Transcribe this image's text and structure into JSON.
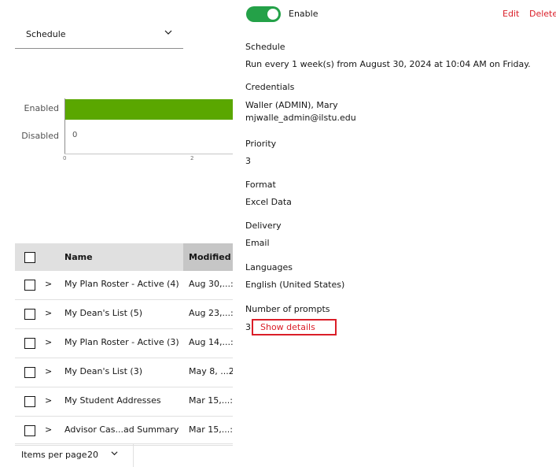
{
  "toolbar": {
    "enable_label": "Enable",
    "enabled_state": true,
    "edit_label": "Edit",
    "delete_label": "Delete"
  },
  "filter": {
    "selected": "Schedule"
  },
  "chart_data": {
    "type": "bar",
    "orientation": "horizontal",
    "categories": [
      "Enabled",
      "Disabled"
    ],
    "values": [
      3,
      0
    ],
    "value_labels": [
      "",
      "0"
    ],
    "x_ticks": [
      "0",
      "2"
    ],
    "xlim": [
      0,
      3
    ],
    "title": "",
    "xlabel": "",
    "ylabel": ""
  },
  "table": {
    "headers": {
      "name": "Name",
      "modified": "Modified"
    },
    "rows": [
      {
        "name": "My Plan Roster - Active (4)",
        "modified": "Aug 30,...:"
      },
      {
        "name": "My Dean's List (5)",
        "modified": "Aug 23,...:"
      },
      {
        "name": "My Plan Roster - Active (3)",
        "modified": "Aug 14,...:"
      },
      {
        "name": "My Dean's List (3)",
        "modified": "May 8, ...2"
      },
      {
        "name": "My Student Addresses",
        "modified": "Mar 15,...:"
      },
      {
        "name": "Advisor Cas...ad Summary",
        "modified": "Mar 15,...:"
      }
    ]
  },
  "pagination": {
    "items_per_page_label": "Items per page",
    "items_per_page_value": "20"
  },
  "details": {
    "schedule_label": "Schedule",
    "schedule_value": "Run every 1 week(s) from August 30, 2024 at 10:04 AM on Friday.",
    "credentials_label": "Credentials",
    "credentials_name": "Waller (ADMIN), Mary",
    "credentials_email": "mjwalle_admin@ilstu.edu",
    "priority_label": "Priority",
    "priority_value": "3",
    "format_label": "Format",
    "format_value": "Excel Data",
    "delivery_label": "Delivery",
    "delivery_value": "Email",
    "languages_label": "Languages",
    "languages_value": "English (United States)",
    "prompts_label": "Number of prompts",
    "prompts_value": "3",
    "show_details_label": "Show details"
  },
  "colors": {
    "accent_red": "#da1e28",
    "toggle_green": "#24a148",
    "bar_green": "#5aa700"
  }
}
